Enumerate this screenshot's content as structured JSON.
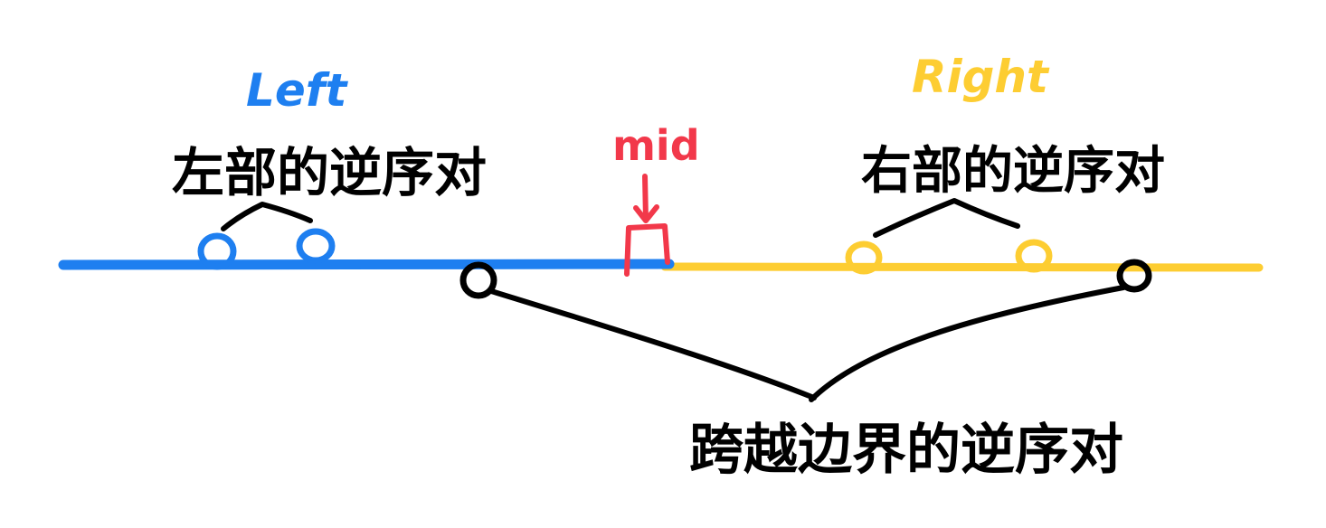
{
  "labels": {
    "left": "Left",
    "right": "Right",
    "mid": "mid",
    "left_pairs": "左部的逆序对",
    "right_pairs": "右部的逆序对",
    "cross_pairs": "跨越边界的逆序对"
  },
  "colors": {
    "left": "#1e7ff0",
    "right": "#fdcd32",
    "mid": "#f2384a",
    "ink": "#000000"
  }
}
